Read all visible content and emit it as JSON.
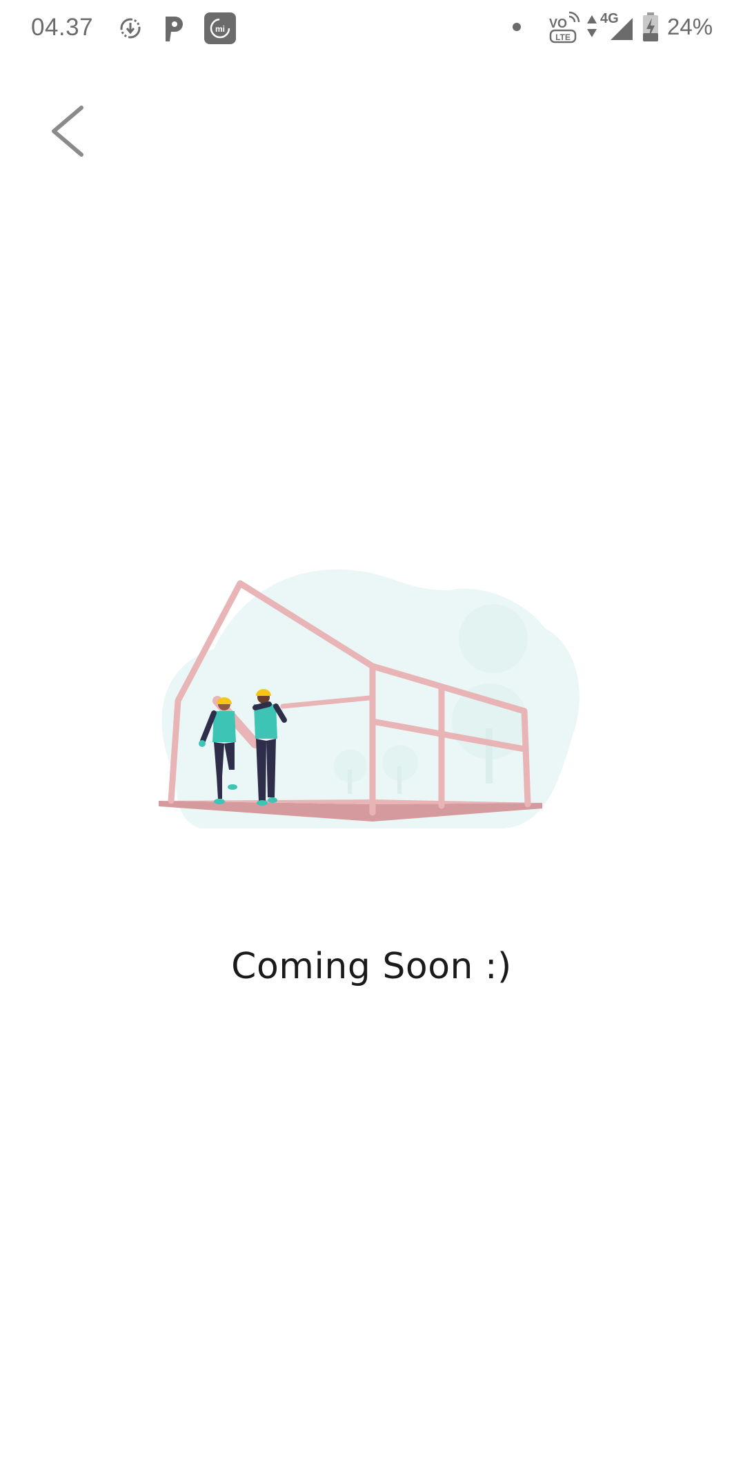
{
  "status_bar": {
    "time": "04.37",
    "battery_percent": "24%",
    "network_type": "4G",
    "volte_label": "VO",
    "lte_label": "LTE",
    "mi_label": "mi",
    "icons": [
      "download-sync-icon",
      "parking-app-icon",
      "mi-app-icon",
      "notification-dot-icon",
      "volte-icon",
      "data-arrows-icon",
      "signal-icon",
      "battery-charging-icon"
    ]
  },
  "header": {
    "back_icon": "chevron-left-icon"
  },
  "main": {
    "illustration_icon": "construction-house-illustration",
    "message": "Coming Soon :)"
  },
  "colors": {
    "background": "#ffffff",
    "status_text": "#6b6b6b",
    "back_icon": "#8a8a8a",
    "message_text": "#1a1a1a",
    "blob": "#eaf7f6",
    "frame": "#e8b4b6",
    "frame_dark": "#d49a9d",
    "worker_shirt": "#3dc4b4",
    "worker_pants": "#2e2e4a",
    "helmet": "#f5c518"
  }
}
